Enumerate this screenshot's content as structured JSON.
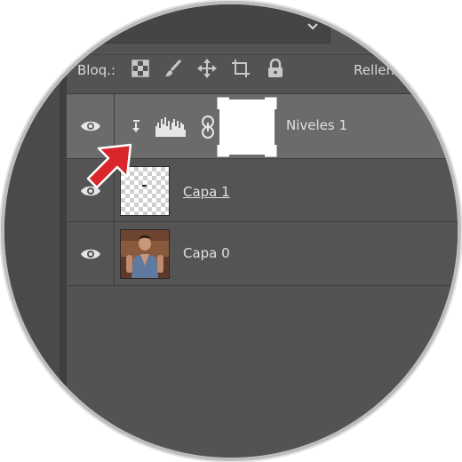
{
  "options_bar": {
    "lock_label": "Bloq.:",
    "fill_label": "Relleno",
    "lock_icons": [
      "lock-transparent-pixels-icon",
      "lock-image-pixels-icon",
      "lock-position-icon",
      "lock-artboard-icon",
      "lock-all-icon"
    ]
  },
  "layers": [
    {
      "name": "Niveles 1",
      "type": "adjustment-levels",
      "visible": true,
      "selected": true,
      "clipped": true
    },
    {
      "name": "Capa 1",
      "type": "pixel",
      "visible": true,
      "selected": false
    },
    {
      "name": "Capa 0",
      "type": "photo",
      "visible": true,
      "selected": false
    }
  ],
  "annotation": {
    "arrow_color": "#d9252b"
  },
  "colors": {
    "panel": "#535353",
    "selected_row": "#6b6b6b",
    "text": "#e0e0e0"
  }
}
